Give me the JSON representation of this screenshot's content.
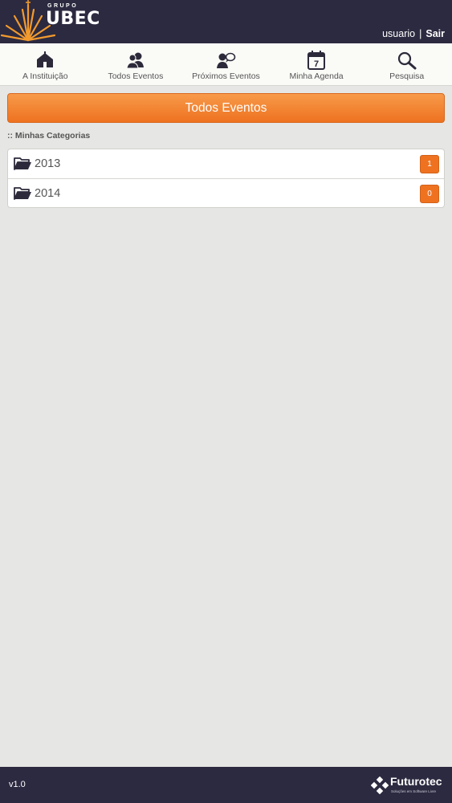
{
  "header": {
    "logo": {
      "small_text": "GRUPO",
      "main_text": "UBEC"
    },
    "user": {
      "name": "usuario",
      "separator": "|",
      "logout_label": "Sair"
    }
  },
  "nav": {
    "items": [
      {
        "label": "A Instituição",
        "icon": "building-icon"
      },
      {
        "label": "Todos Eventos",
        "icon": "users-icon"
      },
      {
        "label": "Próximos Eventos",
        "icon": "user-chat-icon"
      },
      {
        "label": "Minha Agenda",
        "icon": "calendar-icon",
        "icon_text": "7"
      },
      {
        "label": "Pesquisa",
        "icon": "search-icon"
      }
    ]
  },
  "main": {
    "title": "Todos Eventos",
    "section_label": ":: Minhas Categorias",
    "categories": [
      {
        "name": "2013",
        "count": "1",
        "icon": "folder-open-icon"
      },
      {
        "name": "2014",
        "count": "0",
        "icon": "folder-open-icon"
      }
    ]
  },
  "footer": {
    "version": "v1.0",
    "brand_name": "Futurotec",
    "brand_tagline": "Soluções em Software Livre"
  },
  "colors": {
    "header_bg": "#2c2a40",
    "accent": "#ee7220",
    "page_bg": "#e6e6e4"
  }
}
